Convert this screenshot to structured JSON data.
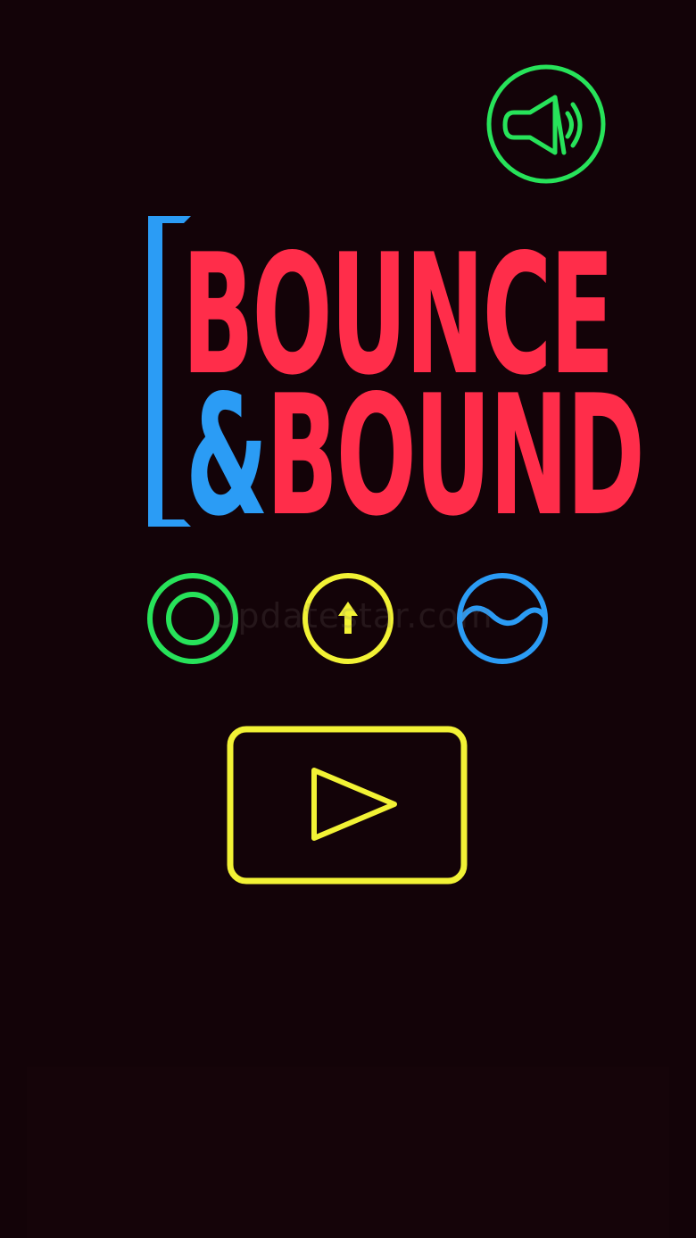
{
  "app": {
    "title_line_1": "BOUNCE",
    "title_amp": "&",
    "title_line_2": "BOUND"
  },
  "colors": {
    "background": "#130308",
    "green": "#27e35a",
    "yellow": "#f2f235",
    "blue": "#2b9cf5",
    "red": "#ff2d4a"
  },
  "controls": {
    "sound_icon": "speaker-icon",
    "modes": [
      {
        "icon": "double-ring-icon",
        "color": "green"
      },
      {
        "icon": "arrow-up-icon",
        "color": "yellow"
      },
      {
        "icon": "wave-icon",
        "color": "blue"
      }
    ],
    "play_icon": "play-triangle-icon"
  },
  "watermark": {
    "text": "Updatestar.com"
  }
}
